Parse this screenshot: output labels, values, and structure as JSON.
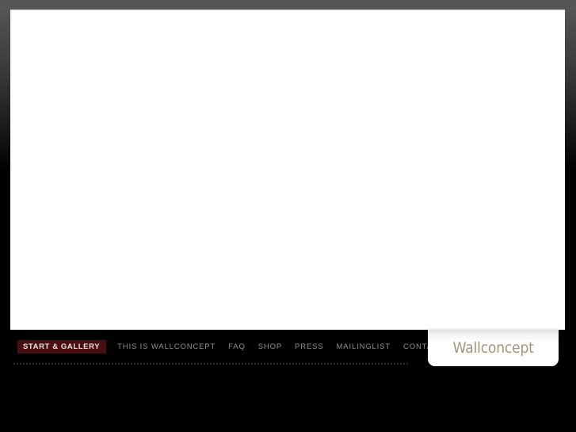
{
  "site": {
    "logo_text": "Wallconcept",
    "brand_color": "#a39578",
    "accent_color": "#4a0e0e",
    "background_color": "#000000",
    "nav_text_color": "#8f8f8f"
  },
  "nav": {
    "items": [
      {
        "label": "START & GALLERY",
        "active": true
      },
      {
        "label": "THIS IS WALLCONCEPT",
        "active": false
      },
      {
        "label": "FAQ",
        "active": false
      },
      {
        "label": "SHOP",
        "active": false
      },
      {
        "label": "PRESS",
        "active": false
      },
      {
        "label": "MAILINGLIST",
        "active": false
      },
      {
        "label": "CONTACT",
        "active": false
      }
    ]
  },
  "main": {
    "gallery_content": ""
  }
}
